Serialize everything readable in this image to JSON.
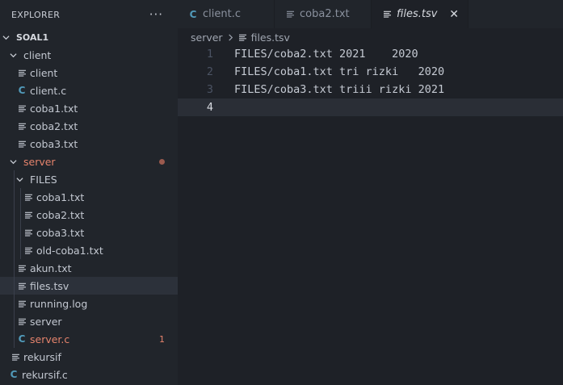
{
  "explorer": {
    "title": "EXPLORER",
    "more_label": "···",
    "workspace": "SOAL1",
    "items": [
      {
        "label": "client",
        "icon": "chevron-down-icon"
      },
      {
        "label": "client",
        "icon": "text-file-icon"
      },
      {
        "label": "client.c",
        "icon": "c-file-icon"
      },
      {
        "label": "coba1.txt",
        "icon": "text-file-icon"
      },
      {
        "label": "coba2.txt",
        "icon": "text-file-icon"
      },
      {
        "label": "coba3.txt",
        "icon": "text-file-icon"
      },
      {
        "label": "server",
        "icon": "chevron-down-icon"
      },
      {
        "label": "FILES",
        "icon": "chevron-down-icon"
      },
      {
        "label": "coba1.txt",
        "icon": "text-file-icon"
      },
      {
        "label": "coba2.txt",
        "icon": "text-file-icon"
      },
      {
        "label": "coba3.txt",
        "icon": "text-file-icon"
      },
      {
        "label": "old-coba1.txt",
        "icon": "text-file-icon"
      },
      {
        "label": "akun.txt",
        "icon": "text-file-icon"
      },
      {
        "label": "files.tsv",
        "icon": "text-file-icon"
      },
      {
        "label": "running.log",
        "icon": "text-file-icon"
      },
      {
        "label": "server",
        "icon": "text-file-icon"
      },
      {
        "label": "server.c",
        "icon": "c-file-icon",
        "problems": "1"
      },
      {
        "label": "rekursif",
        "icon": "text-file-icon"
      },
      {
        "label": "rekursif.c",
        "icon": "c-file-icon"
      }
    ]
  },
  "tabs": [
    {
      "label": "client.c",
      "icon": "c-file-icon"
    },
    {
      "label": "coba2.txt",
      "icon": "text-file-icon"
    },
    {
      "label": "files.tsv",
      "icon": "text-file-icon",
      "active": true,
      "close": "✕"
    }
  ],
  "breadcrumb": {
    "folder": "server",
    "file": "files.tsv"
  },
  "editor": {
    "lines": [
      {
        "number": "1",
        "text": "FILES/coba2.txt 2021    2020"
      },
      {
        "number": "2",
        "text": "FILES/coba1.txt tri rizki   2020"
      },
      {
        "number": "3",
        "text": "FILES/coba3.txt triii rizki 2021"
      },
      {
        "number": "4",
        "text": ""
      }
    ],
    "current_line": "4"
  },
  "colors": {
    "c_icon": "#519aba",
    "error": "#e5836c",
    "modified_dot": "#9b5a4e",
    "active_row": "#2c313a"
  }
}
